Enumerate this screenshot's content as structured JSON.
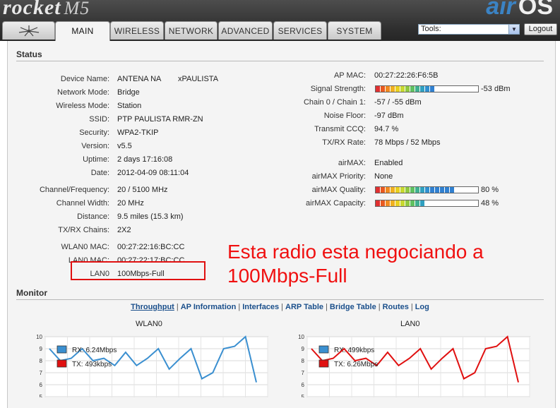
{
  "header": {
    "logo_text": "rocket",
    "logo_model": "M5",
    "brand_air": "air",
    "brand_os": "OS"
  },
  "tabs": [
    {
      "label": "MAIN",
      "active": true
    },
    {
      "label": "WIRELESS",
      "active": false
    },
    {
      "label": "NETWORK",
      "active": false
    },
    {
      "label": "ADVANCED",
      "active": false
    },
    {
      "label": "SERVICES",
      "active": false
    },
    {
      "label": "SYSTEM",
      "active": false
    }
  ],
  "tools": {
    "selected": "Tools:"
  },
  "logout_label": "Logout",
  "status": {
    "title": "Status",
    "left": [
      {
        "label": "Device Name:",
        "value": "ANTENA NA",
        "extra": "xPAULISTA"
      },
      {
        "label": "Network Mode:",
        "value": "Bridge"
      },
      {
        "label": "Wireless Mode:",
        "value": "Station"
      },
      {
        "label": "SSID:",
        "value": "PTP PAULISTA RMR-ZN"
      },
      {
        "label": "Security:",
        "value": "WPA2-TKIP"
      },
      {
        "label": "Version:",
        "value": "v5.5"
      },
      {
        "label": "Uptime:",
        "value": "2 days 17:16:08"
      },
      {
        "label": "Date:",
        "value": "2012-04-09 08:11:04"
      },
      {
        "label": "Channel/Frequency:",
        "value": "20 / 5100 MHz"
      },
      {
        "label": "Channel Width:",
        "value": "20 MHz"
      },
      {
        "label": "Distance:",
        "value": "9.5 miles (15.3 km)"
      },
      {
        "label": "TX/RX Chains:",
        "value": "2X2"
      },
      {
        "label": "WLAN0 MAC:",
        "value": "00:27:22:16:BC:CC"
      },
      {
        "label": "LAN0 MAC:",
        "value": "00:27:22:17:BC:CC"
      },
      {
        "label": "LAN0",
        "value": "100Mbps-Full"
      }
    ],
    "right": [
      {
        "label": "AP MAC:",
        "value": "00:27:22:26:F6:5B"
      },
      {
        "label": "Signal Strength:",
        "value": "-53 dBm",
        "level": 0.62
      },
      {
        "label": "Chain 0 / Chain 1:",
        "value": "-57 / -55 dBm"
      },
      {
        "label": "Noise Floor:",
        "value": "-97 dBm"
      },
      {
        "label": "Transmit CCQ:",
        "value": "94.7 %"
      },
      {
        "label": "TX/RX Rate:",
        "value": "78 Mbps / 52 Mbps"
      },
      {
        "label": "airMAX:",
        "value": "Enabled"
      },
      {
        "label": "airMAX Priority:",
        "value": "None"
      },
      {
        "label": "airMAX Quality:",
        "value": "80 %",
        "level": 0.8
      },
      {
        "label": "airMAX Capacity:",
        "value": "48 %",
        "level": 0.48
      }
    ]
  },
  "annotation": {
    "line1": "Esta radio esta negociando a",
    "line2": "100Mbps-Full"
  },
  "monitor": {
    "title": "Monitor",
    "links": [
      "Throughput",
      "AP Information",
      "Interfaces",
      "ARP Table",
      "Bridge Table",
      "Routes",
      "Log"
    ],
    "separator": "|"
  },
  "chart_data": [
    {
      "type": "line",
      "title": "WLAN0",
      "ylim": [
        4,
        10
      ],
      "yticks": [
        4,
        5,
        6,
        7,
        8,
        9,
        10
      ],
      "series": [
        {
          "name": "RX: 6.24Mbps",
          "color": "#3a8fd0",
          "values": [
            9.0,
            8.0,
            8.2,
            9.0,
            8.0,
            8.2,
            7.6,
            8.7,
            7.6,
            8.2,
            9.0,
            7.3,
            8.2,
            9.0,
            6.5,
            7.0,
            9.0,
            9.2,
            10.0,
            6.2
          ]
        },
        {
          "name": "TX: 493kbps",
          "color": "#e01010",
          "values": []
        }
      ]
    },
    {
      "type": "line",
      "title": "LAN0",
      "ylim": [
        4,
        10
      ],
      "yticks": [
        4,
        5,
        6,
        7,
        8,
        9,
        10
      ],
      "series": [
        {
          "name": "RX: 499kbps",
          "color": "#3a8fd0",
          "values": []
        },
        {
          "name": "TX: 6.26Mbps",
          "color": "#e01010",
          "values": [
            9.0,
            8.0,
            8.2,
            9.0,
            8.0,
            8.2,
            7.6,
            8.7,
            7.6,
            8.2,
            9.0,
            7.3,
            8.2,
            9.0,
            6.5,
            7.0,
            9.0,
            9.2,
            10.0,
            6.2
          ]
        }
      ]
    }
  ]
}
